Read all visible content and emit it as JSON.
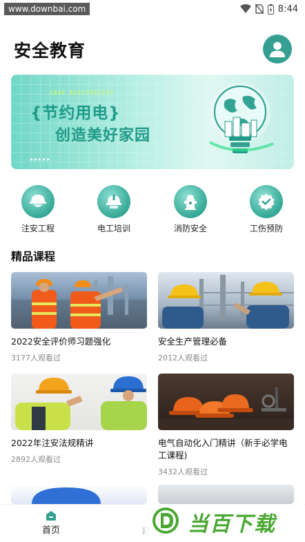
{
  "status_bar": {
    "watermark": "www.downbai.com",
    "time": "8:44"
  },
  "header": {
    "title": "安全教育"
  },
  "banner": {
    "en_text": "SAVE ELECTRICITY",
    "line1": "{节约用电}",
    "line2": "创造美好家园",
    "dots": "▸▸▸▸▸"
  },
  "categories": [
    {
      "label": "注安工程",
      "icon": "helmet-worker-icon"
    },
    {
      "label": "电工培训",
      "icon": "hard-hat-icon"
    },
    {
      "label": "消防安全",
      "icon": "fire-hydrant-icon"
    },
    {
      "label": "工伤预防",
      "icon": "shield-check-icon"
    }
  ],
  "section": {
    "title": "精品课程"
  },
  "courses": [
    {
      "title": "2022安全评价师习题强化",
      "views": "3177人观看过"
    },
    {
      "title": "安全生产管理必备",
      "views": "2012人观看过"
    },
    {
      "title": "2022年注安法规精讲",
      "views": "2892人观看过"
    },
    {
      "title": "电气自动化入门精讲（新手必学电工课程)",
      "views": "3432人观看过"
    }
  ],
  "bottom_nav": {
    "home_label": "首页",
    "second_label": "冠"
  },
  "brand": {
    "text": "当百下载"
  },
  "colors": {
    "accent": "#35a092",
    "banner_text": "#1f9a88",
    "brand_green": "#4aa832"
  }
}
